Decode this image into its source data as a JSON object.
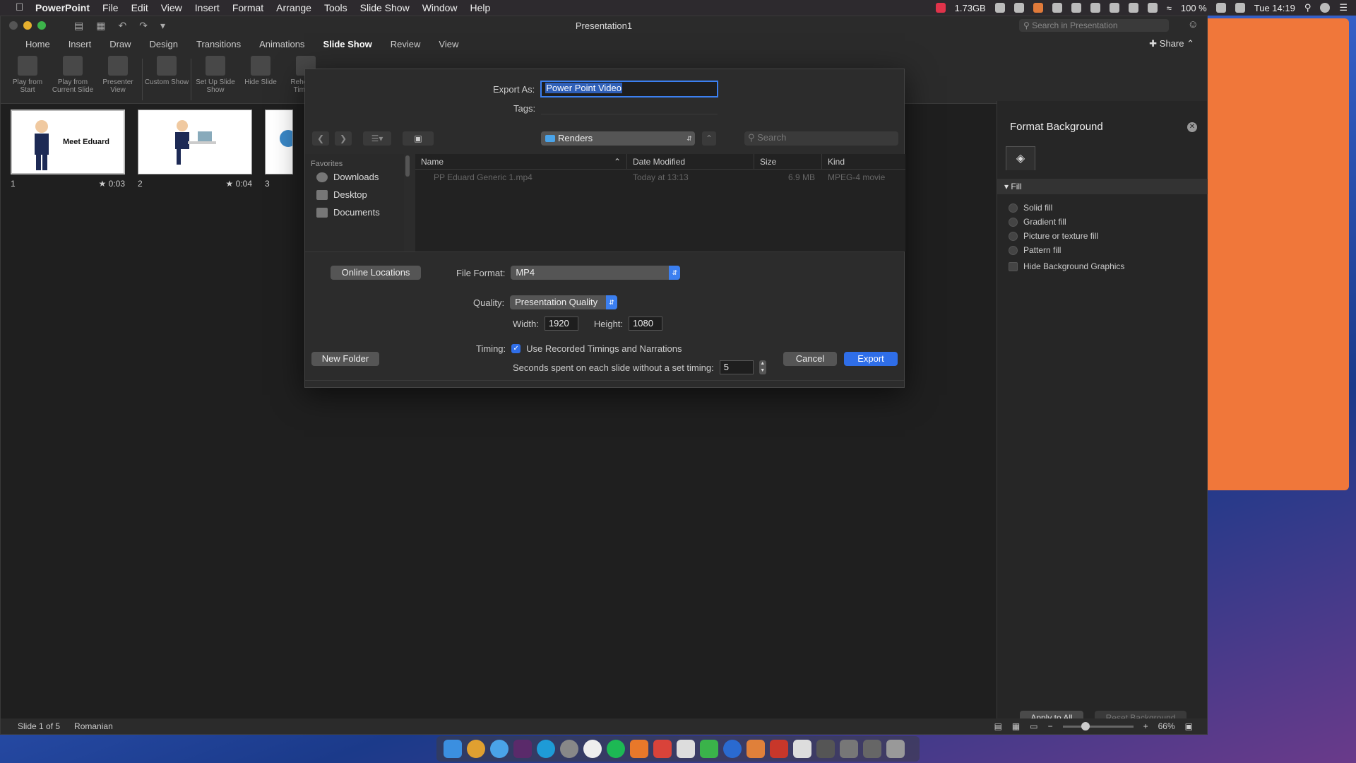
{
  "menubar": {
    "app": "PowerPoint",
    "items": [
      "File",
      "Edit",
      "View",
      "Insert",
      "Format",
      "Arrange",
      "Tools",
      "Slide Show",
      "Window",
      "Help"
    ],
    "memory": "1.73GB",
    "battery": "100 %",
    "clock": "Tue 14:19"
  },
  "window": {
    "title": "Presentation1",
    "search_placeholder": "Search in Presentation",
    "share_label": "Share"
  },
  "tabs": [
    "Home",
    "Insert",
    "Draw",
    "Design",
    "Transitions",
    "Animations",
    "Slide Show",
    "Review",
    "View"
  ],
  "active_tab": "Slide Show",
  "ribbon": [
    "Play from Start",
    "Play from Current Slide",
    "Presenter View",
    "Custom Show",
    "Set Up Slide Show",
    "Hide Slide",
    "Rehearse Timings"
  ],
  "slides": [
    {
      "number": "1",
      "duration": "★ 0:03",
      "title": "Meet Eduard"
    },
    {
      "number": "2",
      "duration": "★ 0:04",
      "title": ""
    },
    {
      "number": "3",
      "duration": "",
      "title": ""
    }
  ],
  "dialog": {
    "export_as_label": "Export As:",
    "export_as_value": "Power Point Video",
    "tags_label": "Tags:",
    "location": "Renders",
    "search_placeholder": "Search",
    "favorites_header": "Favorites",
    "favorites": [
      "Downloads",
      "Desktop",
      "Documents"
    ],
    "columns": [
      "Name",
      "Date Modified",
      "Size",
      "Kind"
    ],
    "files": [
      {
        "name": "PP Eduard Generic 1.mp4",
        "date": "Today at 13:13",
        "size": "6.9 MB",
        "kind": "MPEG-4 movie"
      }
    ],
    "online_locations": "Online Locations",
    "file_format_label": "File Format:",
    "file_format_value": "MP4",
    "quality_label": "Quality:",
    "quality_value": "Presentation Quality",
    "width_label": "Width:",
    "width_value": "1920",
    "height_label": "Height:",
    "height_value": "1080",
    "timing_label": "Timing:",
    "timing_checkbox": "Use Recorded Timings and Narrations",
    "seconds_label": "Seconds spent on each slide without a set timing:",
    "seconds_value": "5",
    "new_folder": "New Folder",
    "cancel": "Cancel",
    "export": "Export"
  },
  "format_background": {
    "title": "Format Background",
    "section": "Fill",
    "options": [
      "Solid fill",
      "Gradient fill",
      "Picture or texture fill",
      "Pattern fill"
    ],
    "hide_graphics": "Hide Background Graphics",
    "apply_all": "Apply to All",
    "reset": "Reset Background"
  },
  "statusbar": {
    "slide": "Slide 1 of 5",
    "language": "Romanian",
    "zoom": "66%"
  },
  "colors": {
    "accent": "#2f6ee8",
    "orange_window": "#f0773a"
  }
}
